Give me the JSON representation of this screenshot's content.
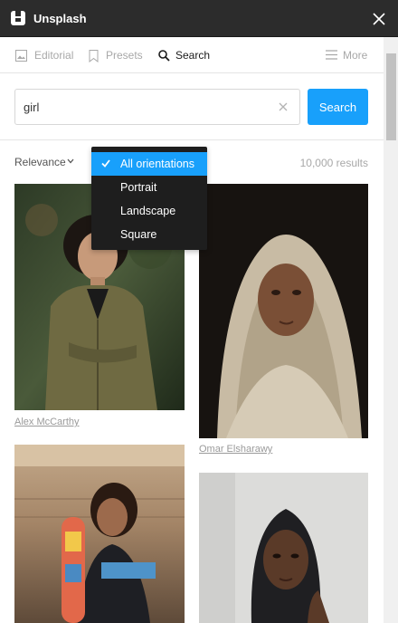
{
  "app": {
    "title": "Unsplash"
  },
  "tabs": [
    {
      "label": "Editorial",
      "icon": "image-icon"
    },
    {
      "label": "Presets",
      "icon": "bookmark-icon"
    },
    {
      "label": "Search",
      "icon": "search-icon"
    },
    {
      "label": "More",
      "icon": "menu-icon"
    }
  ],
  "search": {
    "value": "girl",
    "button_label": "Search"
  },
  "filters": {
    "sort_label": "Relevance",
    "results_count": "10,000 results"
  },
  "orientation_menu": {
    "items": [
      "All orientations",
      "Portrait",
      "Landscape",
      "Square"
    ],
    "selected": "All orientations"
  },
  "photos": [
    {
      "credit": "Alex McCarthy"
    },
    {
      "credit": "Omar Elsharawy"
    },
    {
      "credit": ""
    },
    {
      "credit": ""
    }
  ],
  "colors": {
    "accent": "#18a0fb",
    "titlebar": "#2c2c2c",
    "menu_bg": "#1e1e1e"
  }
}
